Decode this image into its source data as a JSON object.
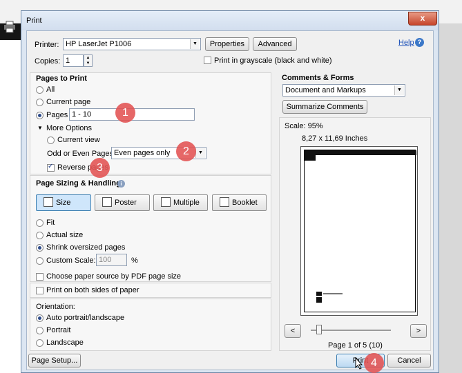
{
  "window": {
    "title": "Print",
    "close": "x",
    "help": "Help"
  },
  "printer": {
    "label": "Printer:",
    "value": "HP LaserJet P1006",
    "properties": "Properties",
    "advanced": "Advanced",
    "copies_label": "Copies:",
    "copies_value": "1",
    "grayscale": "Print in grayscale (black and white)"
  },
  "pages_to_print": {
    "heading": "Pages to Print",
    "all": "All",
    "current_page": "Current page",
    "pages": "Pages",
    "pages_value": "1 - 10",
    "more_options": "More Options",
    "current_view": "Current view",
    "odd_even_label": "Odd or Even Pages:",
    "odd_even_value": "Even pages only",
    "reverse": "Reverse pages"
  },
  "sizing": {
    "heading": "Page Sizing & Handling",
    "tabs": [
      "Size",
      "Poster",
      "Multiple",
      "Booklet"
    ],
    "fit": "Fit",
    "actual": "Actual size",
    "shrink": "Shrink oversized pages",
    "custom": "Custom Scale:",
    "custom_value": "100",
    "percent": "%",
    "paper_source": "Choose paper source by PDF page size"
  },
  "duplex": "Print on both sides of paper",
  "orientation": {
    "heading": "Orientation:",
    "auto": "Auto portrait/landscape",
    "portrait": "Portrait",
    "landscape": "Landscape"
  },
  "comments": {
    "heading": "Comments & Forms",
    "value": "Document and Markups",
    "summarize": "Summarize Comments"
  },
  "preview": {
    "scale": "Scale: 95%",
    "size": "8,27 x 11,69 Inches",
    "page_info": "Page 1 of 5 (10)",
    "slider_fraction": 0.1
  },
  "buttons": {
    "page_setup": "Page Setup...",
    "print": "Print",
    "cancel": "Cancel",
    "prev": "<",
    "next": ">"
  },
  "badges": [
    "1",
    "2",
    "3",
    "4"
  ]
}
